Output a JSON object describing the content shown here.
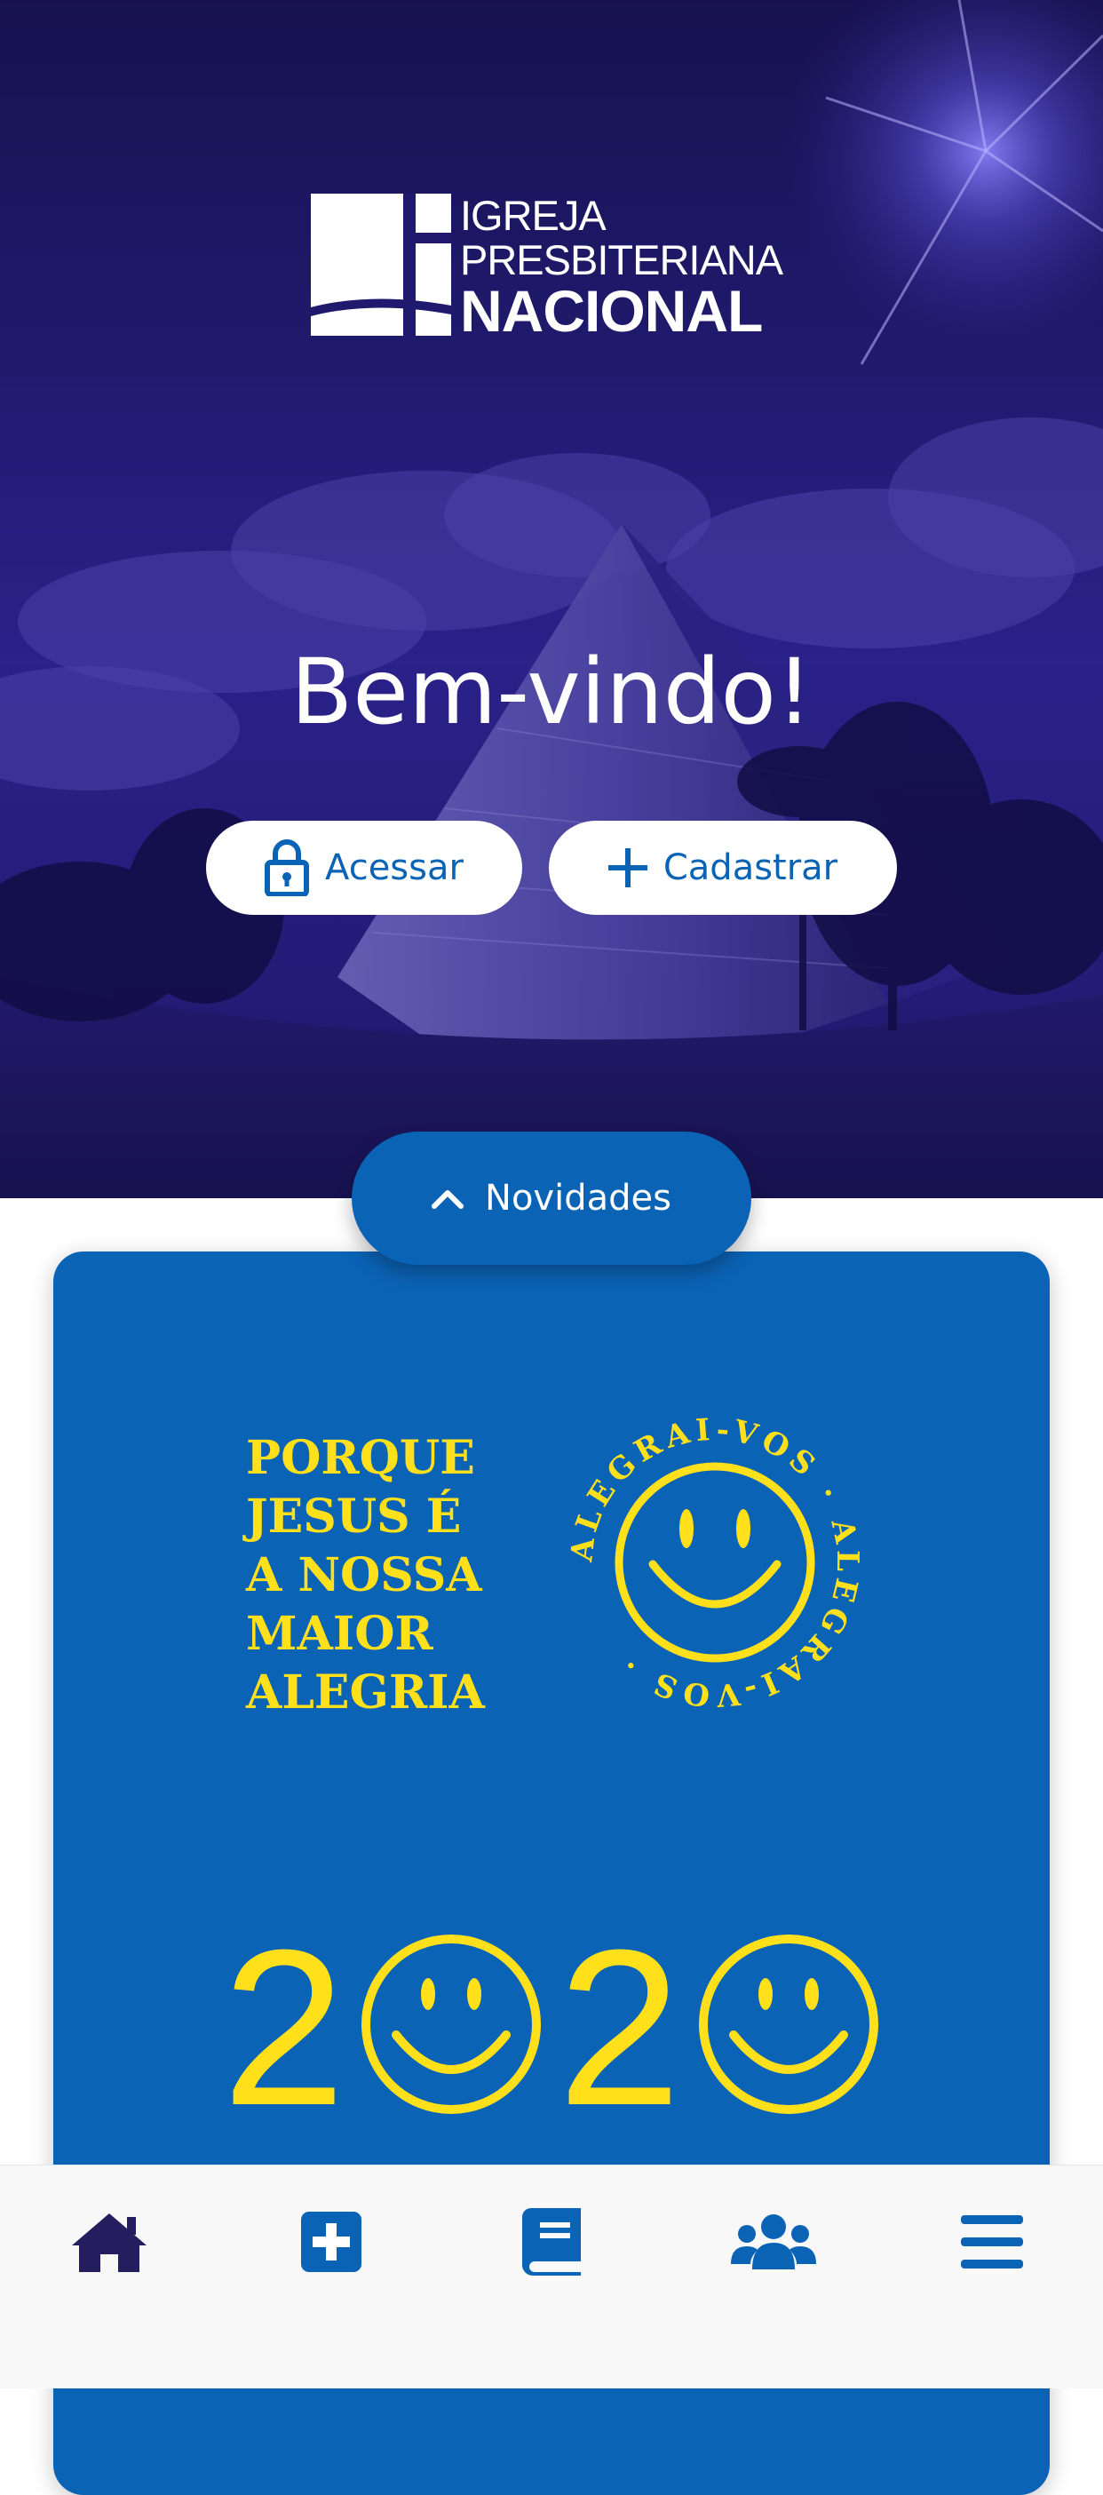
{
  "brand": {
    "line1": "IGREJA",
    "line2": "PRESBITERIANA",
    "line3": "NACIONAL",
    "color": "#ffffff"
  },
  "hero": {
    "welcome": "Bem-vindo!",
    "login_label": "Acessar",
    "register_label": "Cadastrar",
    "login_icon": "lock-icon",
    "register_icon": "plus-icon"
  },
  "news": {
    "tab_label": "Novidades",
    "tab_icon": "chevron-up-icon",
    "card": {
      "tagline": [
        "PORQUE",
        "JESUS É",
        "A NOSSA",
        "MAIOR",
        "ALEGRIA"
      ],
      "ring_text": "ALEGRAI-VOS · ALEGRAI-VOS ·",
      "year_digits": [
        "2",
        "2"
      ],
      "background": "#0b63b6",
      "accent": "#ffe01b"
    }
  },
  "bottom_nav": {
    "items": [
      {
        "icon": "home-icon",
        "active": true
      },
      {
        "icon": "plus-square-icon",
        "active": false
      },
      {
        "icon": "book-icon",
        "active": false
      },
      {
        "icon": "users-icon",
        "active": false
      },
      {
        "icon": "menu-icon",
        "active": false
      }
    ]
  },
  "colors": {
    "primary": "#0b63b6",
    "hero_dark": "#1d1765",
    "active_nav": "#241e5e"
  }
}
